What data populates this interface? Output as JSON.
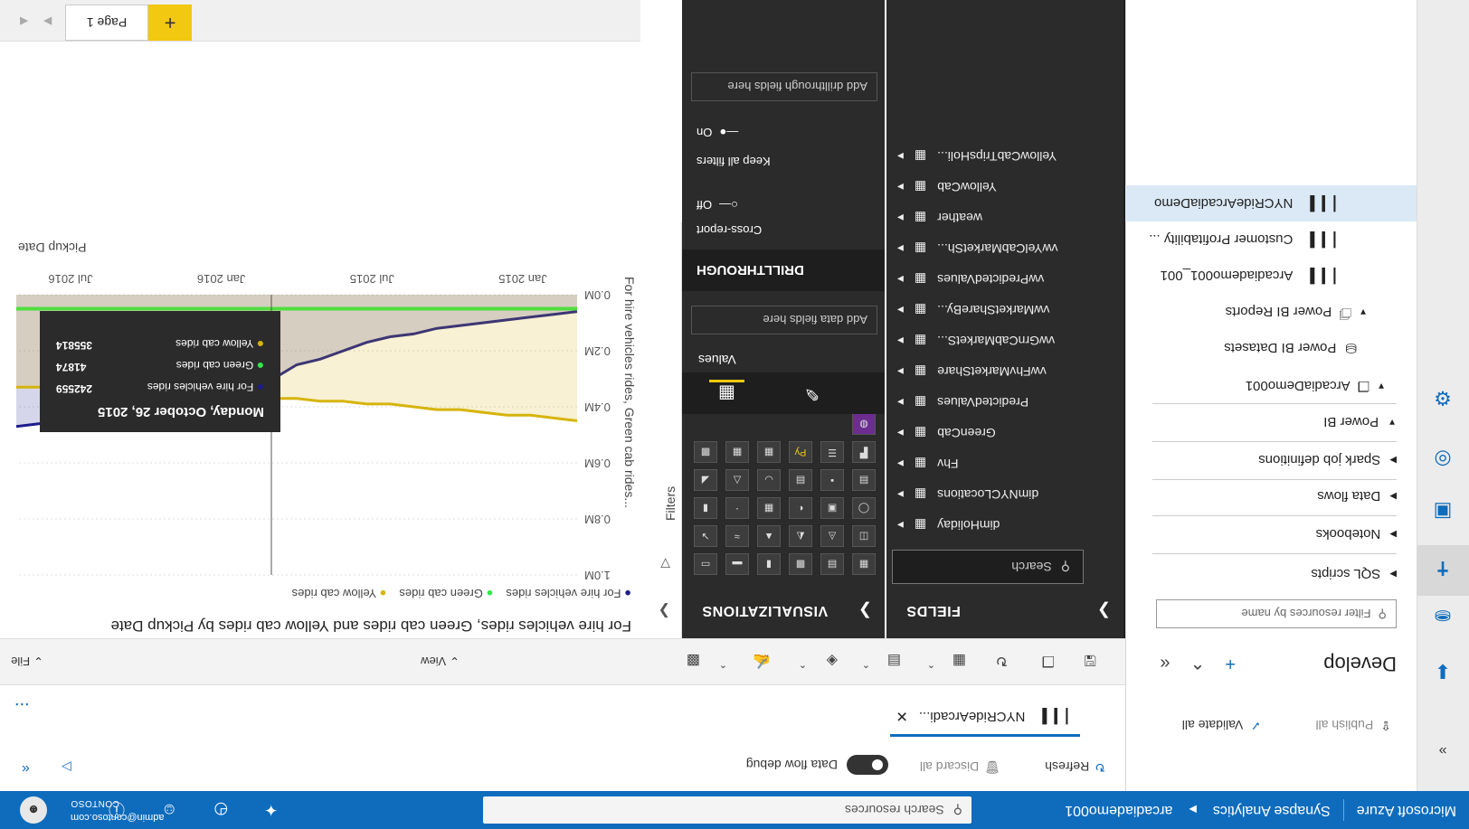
{
  "topbar": {
    "brand": "Microsoft Azure",
    "service": "Synapse Analytics",
    "workspace": "arcadiademo001",
    "search_placeholder": "Search resources",
    "user_org": "CONTOSO",
    "user_email": "admin@contoso.com"
  },
  "explorer": {
    "publish_all": "Publish all",
    "validate_all": "Validate all",
    "title": "Develop",
    "filter_placeholder": "Filter resources by name",
    "sections": [
      "SQL scripts",
      "Notebooks",
      "Data flows",
      "Spark job definitions",
      "Power BI"
    ],
    "workspace": "ArcadiaDemo001",
    "datasets": "Power BI Datasets",
    "reports": "Power BI Reports",
    "report_items": [
      "Arcadiademo001_001",
      "Customer Profitability ...",
      "NYCRideArcadiaDemo"
    ]
  },
  "main": {
    "refresh": "Refresh",
    "discard_all": "Discard all",
    "data_flow_debug": "Data flow debug",
    "doc_tab": "NYCRideArcadi...",
    "more": "...",
    "menu_file": "File",
    "menu_view": "View",
    "filters_label": "Filters",
    "page_tab": "Page 1",
    "add_page": "+"
  },
  "viz": {
    "title": "VISUALIZATIONS",
    "values_label": "Values",
    "values_placeholder": "Add data fields here",
    "drillthrough": "DRILLTHROUGH",
    "cross_report": "Cross-report",
    "off": "Off",
    "keep_all_filters": "Keep all filters",
    "on": "On",
    "drill_placeholder": "Add drillthrough fields here",
    "py_label": "Py"
  },
  "fields": {
    "title": "FIELDS",
    "search_placeholder": "Search",
    "items": [
      "dimHoliday",
      "dimNYCLocations",
      "Fhv",
      "GreenCab",
      "PredictedValues",
      "vwFhvMarketShare",
      "vwGrnCabMarketS...",
      "vwMarketShareBy...",
      "vwPredictedValues",
      "vwYelCabMarketSh...",
      "weather",
      "YellowCab",
      "YellowCabTripsHoli..."
    ]
  },
  "chart_data": {
    "type": "area",
    "title": "For hire vehicles rides, Green cab rides and Yellow cab rides by Pickup Date",
    "xlabel": "Pickup Date",
    "ylabel": "For hire vehicles rides, Green cab rides...",
    "x_ticks": [
      "Jan 2015",
      "Jul 2015",
      "Jan 2016",
      "Jul 2016"
    ],
    "y_ticks": [
      "0.0M",
      "0.2M",
      "0.4M",
      "0.6M",
      "0.8M",
      "1.0M"
    ],
    "ylim": [
      0,
      1000000
    ],
    "series": [
      {
        "name": "For hire vehicles rides",
        "color": "#1c1c8c",
        "values": [
          0.06,
          0.07,
          0.08,
          0.09,
          0.1,
          0.11,
          0.12,
          0.14,
          0.15,
          0.17,
          0.2,
          0.23,
          0.25,
          0.3,
          0.33,
          0.36,
          0.38,
          0.39,
          0.4,
          0.42,
          0.43,
          0.44,
          0.45,
          0.46,
          0.47
        ]
      },
      {
        "name": "Green cab rides",
        "color": "#33e84a",
        "values": [
          0.05,
          0.05,
          0.05,
          0.05,
          0.05,
          0.05,
          0.05,
          0.05,
          0.05,
          0.05,
          0.05,
          0.05,
          0.05,
          0.05,
          0.05,
          0.05,
          0.05,
          0.05,
          0.05,
          0.05,
          0.05,
          0.05,
          0.05,
          0.05,
          0.05
        ]
      },
      {
        "name": "Yellow cab rides",
        "color": "#d6b40c",
        "values": [
          0.45,
          0.44,
          0.43,
          0.43,
          0.42,
          0.41,
          0.41,
          0.4,
          0.39,
          0.39,
          0.38,
          0.38,
          0.37,
          0.37,
          0.36,
          0.36,
          0.36,
          0.35,
          0.35,
          0.34,
          0.34,
          0.34,
          0.33,
          0.33,
          0.33
        ]
      }
    ],
    "legend": "bottom-left",
    "tooltip": {
      "date": "Monday, October 26, 2015",
      "rows": [
        {
          "label": "For hire vehicles rides",
          "value": "242559",
          "color": "#1c1c8c"
        },
        {
          "label": "Green cab rides",
          "value": "41874",
          "color": "#33e84a"
        },
        {
          "label": "Yellow cab rides",
          "value": "355814",
          "color": "#d6b40c"
        }
      ]
    }
  }
}
